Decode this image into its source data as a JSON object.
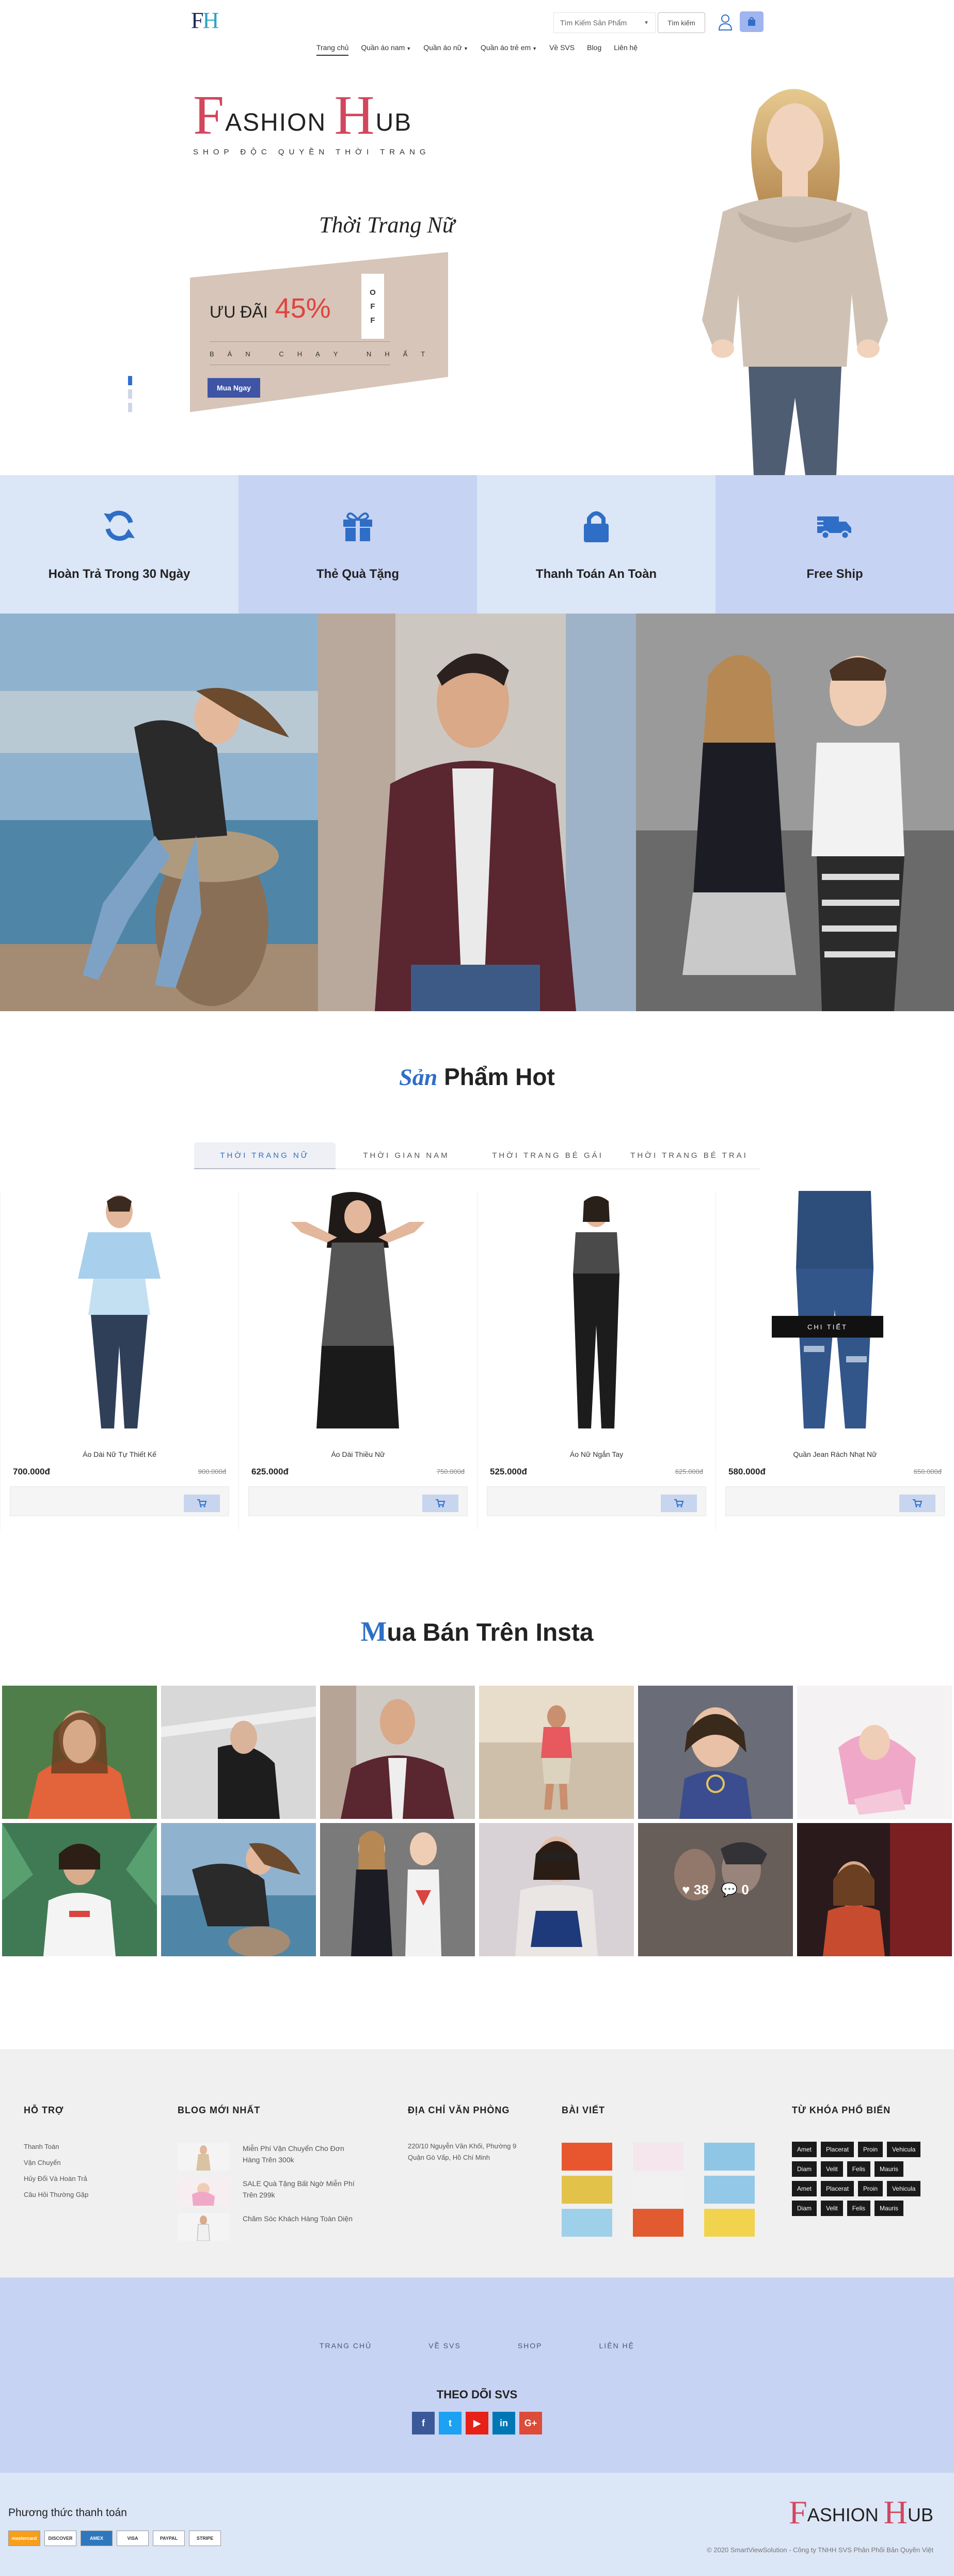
{
  "header": {
    "logo_f": "F",
    "logo_h": "H",
    "search_placeholder": "Tìm Kiếm Sản Phẩm",
    "search_button": "Tìm kiếm",
    "nav": [
      {
        "label": "Trang chủ",
        "dropdown": false
      },
      {
        "label": "Quần áo nam",
        "dropdown": true
      },
      {
        "label": "Quần áo nữ",
        "dropdown": true
      },
      {
        "label": "Quần áo trẻ em",
        "dropdown": true
      },
      {
        "label": "Về SVS",
        "dropdown": false
      },
      {
        "label": "Blog",
        "dropdown": false
      },
      {
        "label": "Liên hệ",
        "dropdown": false
      }
    ]
  },
  "hero": {
    "logo_big_f": "F",
    "logo_rest_1": "ASHION",
    "logo_big_h": "H",
    "logo_rest_2": "UB",
    "tagline": "SHOP ĐỘC QUYỀN THỜI TRANG",
    "title": "Thời Trang Nữ",
    "promo_label": "ƯU ĐÃI",
    "promo_percent": "45%",
    "off_letters": [
      "O",
      "F",
      "F"
    ],
    "best_seller": "BÁN CHẠY NHẤT",
    "button": "Mua Ngay",
    "slide_count": 3,
    "active_slide": 1
  },
  "features": [
    {
      "label": "Hoàn Trả Trong 30 Ngày",
      "icon": "refresh-icon"
    },
    {
      "label": "Thẻ Quà Tặng",
      "icon": "gift-icon"
    },
    {
      "label": "Thanh Toán An Toàn",
      "icon": "lock-icon"
    },
    {
      "label": "Free Ship",
      "icon": "truck-icon"
    }
  ],
  "hot": {
    "title_first": "Sản",
    "title_rest": " Phẩm Hot",
    "tabs": [
      "THỜI TRANG NỮ",
      "THỜI GIAN NAM",
      "THỜI TRANG BÉ GÁI",
      "THỜI TRANG BÉ TRAI"
    ],
    "active_tab": 0,
    "detail_label": "CHI TIẾT",
    "products": [
      {
        "name": "Áo Dài Nữ Tự Thiết Kế",
        "price": "700.000đ",
        "old_price": "900.000đ"
      },
      {
        "name": "Áo Dài Thiều Nữ",
        "price": "625.000đ",
        "old_price": "750.000đ"
      },
      {
        "name": "Áo Nữ Ngắn Tay",
        "price": "525.000đ",
        "old_price": "625.000đ"
      },
      {
        "name": "Quần Jean Rách Nhạt Nữ",
        "price": "580.000đ",
        "old_price": "650.000đ"
      }
    ]
  },
  "insta": {
    "title_first": "M",
    "title_rest": "ua Bán Trên Insta",
    "likes": "38",
    "comments": "0"
  },
  "footer": {
    "support_title": "HỖ TRỢ",
    "support_links": [
      "Thanh Toán",
      "Vận Chuyển",
      "Hủy Đổi Và Hoàn Trả",
      "Câu Hỏi Thường Gặp"
    ],
    "blog_title": "BLOG MỚI NHẤT",
    "blog_items": [
      "Miễn Phí Vận Chuyển Cho Đơn Hàng Trên 300k",
      "SALE Quà Tặng Bất Ngờ Miễn Phí Trên 299k",
      "Chăm Sóc Khách Hàng Toàn Diện"
    ],
    "address_title": "ĐỊA CHỈ VĂN PHÒNG",
    "address": "220/10 Nguyễn Văn Khối, Phường 9 Quận Gò Vấp, Hồ Chí Minh",
    "posts_title": "BÀI VIẾT",
    "tags_title": "TỪ KHÓA PHỔ BIẾN",
    "tags": [
      "Amet",
      "Placerat",
      "Proin",
      "Vehicula",
      "Diam",
      "Velit",
      "Felis",
      "Mauris",
      "Amet",
      "Placerat",
      "Proin",
      "Vehicula",
      "Diam",
      "Velit",
      "Felis",
      "Mauris"
    ]
  },
  "subscribe": {
    "links": [
      "TRANG CHỦ",
      "VỀ SVS",
      "SHOP",
      "LIÊN HỆ"
    ],
    "follow": "THEO DÕI SVS",
    "socials": [
      {
        "name": "facebook-icon",
        "glyph": "f",
        "color": "#3b5998"
      },
      {
        "name": "twitter-icon",
        "glyph": "t",
        "color": "#1da1f2"
      },
      {
        "name": "youtube-icon",
        "glyph": "▶",
        "color": "#e62117"
      },
      {
        "name": "linkedin-icon",
        "glyph": "in",
        "color": "#0077b5"
      },
      {
        "name": "google-plus-icon",
        "glyph": "G+",
        "color": "#dd4b39"
      }
    ]
  },
  "bottom": {
    "pay_title": "Phương thức thanh toán",
    "pay_methods": [
      "mastercard",
      "DISCOVER",
      "AMEX",
      "VISA",
      "PAYPAL",
      "STRIPE"
    ],
    "logo_big_f": "F",
    "logo_rest_1": "ASHION ",
    "logo_big_h": "H",
    "logo_rest_2": "UB",
    "copyright": "© 2020 SmartViewSolution - Công ty TNHH SVS Phân Phối Bản Quyền Việt"
  },
  "colors": {
    "accent_blue": "#2f6ec6",
    "brand_pink": "#d2465e",
    "promo_red": "#e0433f",
    "feature_light": "#dbe6f6",
    "feature_mid": "#c7d3f3"
  }
}
